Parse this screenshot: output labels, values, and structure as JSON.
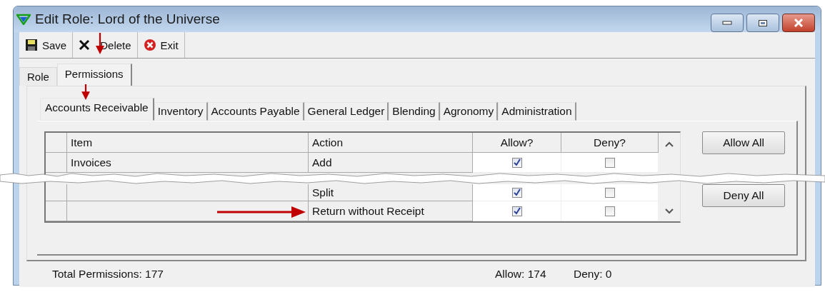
{
  "window": {
    "title": "Edit Role: Lord of the Universe"
  },
  "toolbar": [
    {
      "kind": "save",
      "label": "Save"
    },
    {
      "kind": "delete",
      "label": "Delete"
    },
    {
      "kind": "exit",
      "label": "Exit"
    }
  ],
  "tabs": [
    {
      "label": "Role",
      "selected": false
    },
    {
      "label": "Permissions",
      "selected": true
    }
  ],
  "subtabs": [
    {
      "label": "Accounts Receivable",
      "selected": true
    },
    {
      "label": "Inventory",
      "selected": false
    },
    {
      "label": "Accounts Payable",
      "selected": false
    },
    {
      "label": "General Ledger",
      "selected": false
    },
    {
      "label": "Blending",
      "selected": false
    },
    {
      "label": "Agronomy",
      "selected": false
    },
    {
      "label": "Administration",
      "selected": false
    }
  ],
  "table": {
    "columns": [
      "Item",
      "Action",
      "Allow?",
      "Deny?"
    ],
    "rows": [
      {
        "item": "Invoices",
        "action": "Add",
        "allow": true,
        "deny": false
      },
      {
        "action": "Split",
        "allow": true,
        "deny": false,
        "torn_above": true
      },
      {
        "action": "Return without Receipt",
        "allow": true,
        "deny": false
      }
    ]
  },
  "side_buttons": [
    "Allow All",
    "Deny All"
  ],
  "status_bar": {
    "total": "Total Permissions: 177",
    "allow": "Allow: 174",
    "deny": "Deny: 0"
  }
}
